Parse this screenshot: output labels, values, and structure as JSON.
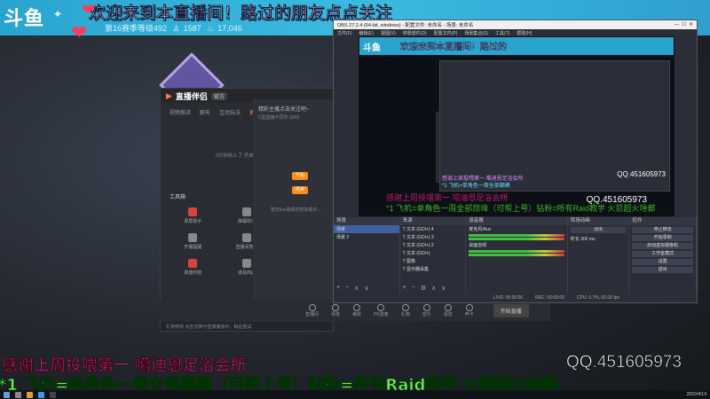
{
  "stream": {
    "logo": "斗鱼",
    "banner_text": "欢迎来到本直播间！路过的朋友点点关注",
    "rank": "第16赛季等级492",
    "followers": "1587",
    "hot": "17,046"
  },
  "capture_app": {
    "logo": "直播伴侣",
    "badge": "官方",
    "tabs": [
      "视频推流",
      "聊天",
      "互动玩法",
      "更多"
    ],
    "active_tab": "更多",
    "empty_msg": "0分钟前上了 开启精彩直播吧",
    "toolbox_title": "工具箱",
    "tools": [
      {
        "label": "录屏助手",
        "red": true
      },
      {
        "label": "弹幕助手",
        "red": false
      },
      {
        "label": "主播任务",
        "red": false
      },
      {
        "label": "开播提醒",
        "red": false
      },
      {
        "label": "直播间管理",
        "red": false
      },
      {
        "label": "更多",
        "red": false
      },
      {
        "label": "高能时刻",
        "red": true
      },
      {
        "label": "道具商店",
        "red": false
      },
      {
        "label": "粉丝团",
        "red": false
      }
    ],
    "footer": "礼物特效 点击切换可直接播放中，稍后重试"
  },
  "main_panel": {
    "header": "精彩主播点击关注吧~",
    "sub": "C型直播不同字 3343",
    "btn1": "开始",
    "btn2": "结束",
    "hint": "暂无live视频内容加载中..."
  },
  "bottom_toolbar": {
    "items": [
      "直播间",
      "场景",
      "美颜",
      "PK连麦",
      "礼物",
      "音乐",
      "语音",
      "声卡"
    ],
    "start_label": "开始直播"
  },
  "obs": {
    "title": "OBS 27.2.4 (64-bit, windows) - 配置文件: 未命名 - 场景: 未命名",
    "menu": [
      "文件(F)",
      "编辑(E)",
      "视图(V)",
      "停靠部件(D)",
      "配置文件(P)",
      "场景集合(S)",
      "工具(T)",
      "帮助(H)"
    ],
    "preview_banner": "欢迎来到本直播间！路过的",
    "preview_logo": "斗鱼",
    "preview_qq": "QQ.451605973",
    "preview_cap1": "感谢上周投喂第一 噶迪恩足浴会所",
    "preview_cap2": "*1 飞机=单角色一周全部巅峰（可帮上号）钻粉=所有Raid教学 火箭超火啥都",
    "inner_cap1": "感谢上周投喂第一 噶迪恩足浴会所",
    "inner_cap2": "*1 飞机=单角色一周全部巅峰",
    "inner_qq": "QQ.451605973",
    "scene_title": "场景",
    "scenes": [
      "场景",
      "场景 2"
    ],
    "source_title": "来源",
    "sources": [
      "文本 (GDI+) 4",
      "文本 (GDI+) 3",
      "文本 (GDI+) 2",
      "文本 (GDI+)",
      "图像",
      "显示器采集"
    ],
    "mixer_title": "混音器",
    "mixer_channels": [
      "麦克风/Aux",
      "桌面音频"
    ],
    "transition_title": "转场动画",
    "transition_value": "淡出",
    "duration_label": "时长",
    "duration_value": "300 ms",
    "controls_title": "控件",
    "controls": [
      "停止推流",
      "开始录制",
      "启动虚拟摄像机",
      "工作室模式",
      "设置",
      "退出"
    ],
    "status": [
      "LIVE: 00:00:00",
      "REC: 00:00:00",
      "CPU: 0.7%, 60.00 fps"
    ]
  },
  "captions": {
    "line1": "感谢上周投喂第一 噶迪恩足浴会所",
    "line2": "*1 飞机=单角色一周全部巅峰（可帮上号）钻粉=所有Raid教学 火箭超火啥都",
    "qq": "QQ.451605973"
  },
  "taskbar": {
    "clock": "2022/4/14"
  }
}
